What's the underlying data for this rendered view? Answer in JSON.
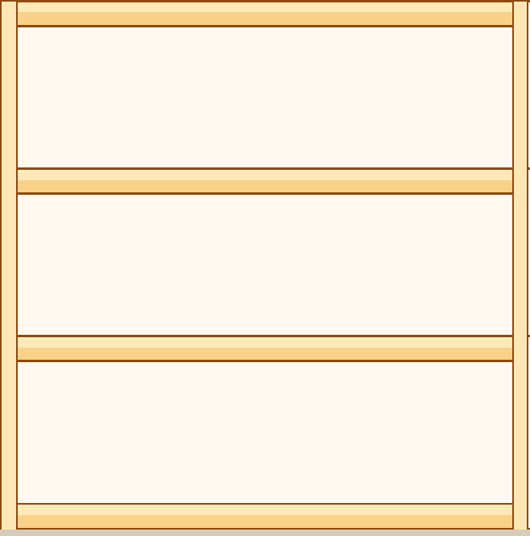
{
  "bookshelf": {
    "shelf_count": 3,
    "compartments": [
      {
        "items": []
      },
      {
        "items": []
      },
      {
        "items": []
      }
    ],
    "colors": {
      "wood_light": "#ffe9b8",
      "wood_mid": "#fad287",
      "outline": "#8b4a10",
      "interior": "#fff9f2",
      "floor_shadow": "#d6cbbd"
    }
  }
}
